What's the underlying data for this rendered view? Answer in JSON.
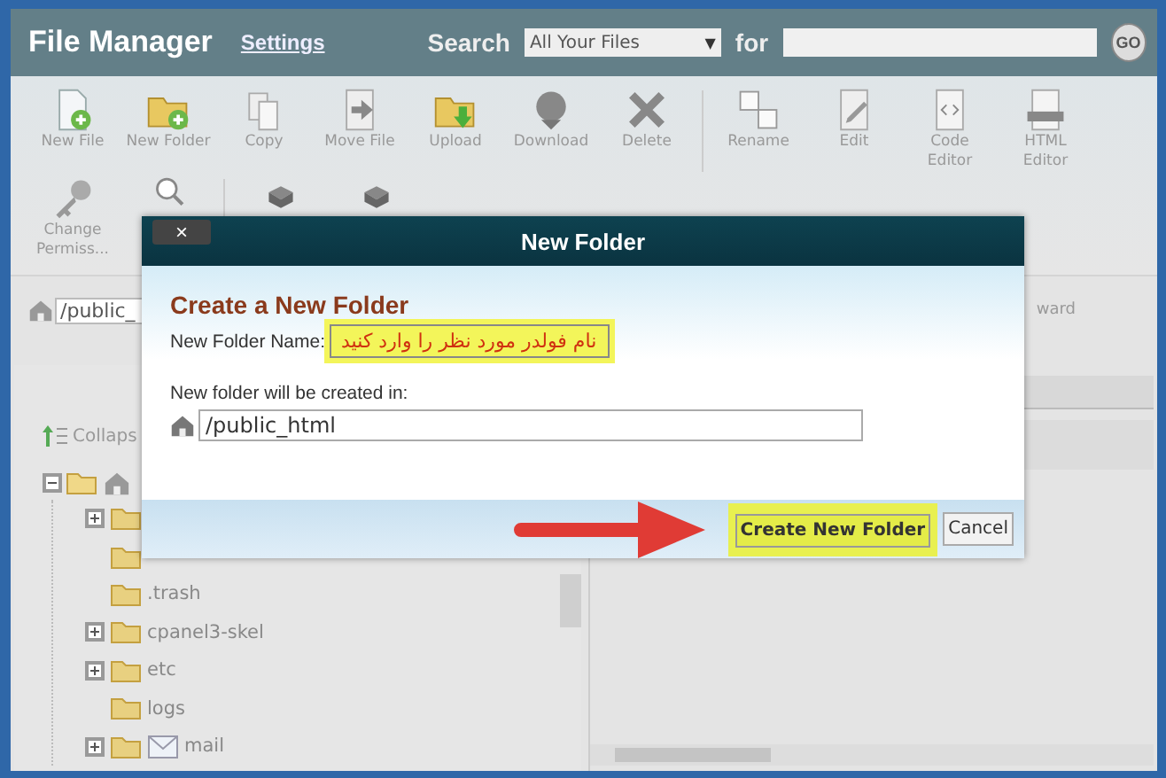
{
  "header": {
    "title": "File Manager",
    "settings_link": "Settings",
    "search_label": "Search",
    "search_scope": "All Your Files",
    "scope_caret": "▼",
    "for_label": "for",
    "go_button": "GO"
  },
  "toolbar_rows": [
    [
      {
        "kind": "new-file",
        "label": "New File"
      },
      {
        "kind": "new-folder",
        "label": "New Folder"
      },
      {
        "kind": "copy",
        "label": "Copy"
      },
      {
        "kind": "move",
        "label": "Move File"
      },
      {
        "kind": "upload",
        "label": "Upload"
      },
      {
        "kind": "download",
        "label": "Download"
      },
      {
        "kind": "delete",
        "label": "Delete"
      },
      {
        "kind": "divider"
      },
      {
        "kind": "rename",
        "label": "Rename"
      },
      {
        "kind": "edit",
        "label": "Edit"
      },
      {
        "kind": "code",
        "label": "Code Editor"
      },
      {
        "kind": "html",
        "label": "HTML Editor"
      }
    ],
    [
      {
        "kind": "key",
        "label": "Change Permiss..."
      },
      {
        "kind": "search"
      },
      {
        "kind": "divider"
      },
      {
        "kind": "box"
      },
      {
        "kind": "box"
      }
    ]
  ],
  "path": {
    "value": "/public_",
    "forward_fragment": "ward"
  },
  "tree": {
    "collapse_label": "Collaps",
    "root_expanded": true,
    "children": [
      {
        "kind": "folder",
        "expandable": true
      },
      {
        "kind": "folder",
        "expandable": false
      },
      {
        "kind": "folder",
        "label": ".trash",
        "expandable": false
      },
      {
        "kind": "folder",
        "label": "cpanel3-skel",
        "expandable": true
      },
      {
        "kind": "folder",
        "label": "etc",
        "expandable": true
      },
      {
        "kind": "folder",
        "label": "logs",
        "expandable": false
      },
      {
        "kind": "mail",
        "label": "mail",
        "expandable": true
      }
    ]
  },
  "dialog": {
    "title": "New Folder",
    "close_button": "×",
    "heading": "Create a New Folder",
    "name_label": "New Folder Name:",
    "name_value": "نام فولدر مورد نظر را وارد کنید",
    "name_highlighted": true,
    "location_label": "New folder will be created in:",
    "location_value": "/public_html",
    "create_button": "Create New Folder",
    "create_highlighted": true,
    "cancel_button": "Cancel"
  }
}
